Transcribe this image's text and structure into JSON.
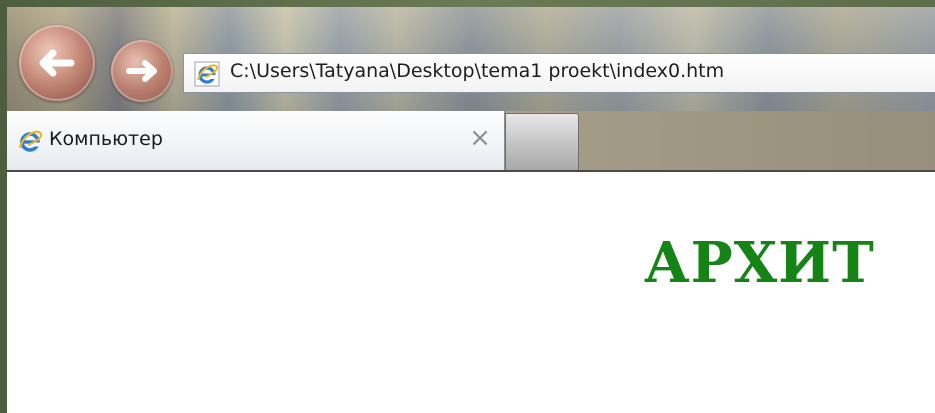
{
  "address_bar": {
    "url": "C:\\Users\\Tatyana\\Desktop\\tema1 proekt\\index0.htm"
  },
  "tab": {
    "title": "Компьютер",
    "close_glyph": "×"
  },
  "page": {
    "heading": "АРХИТ"
  },
  "icons": {
    "back": "back-arrow-icon",
    "forward": "forward-arrow-icon",
    "page": "ie-logo-icon"
  },
  "colors": {
    "heading": "#168317",
    "ie_blue": "#2a7fd4",
    "ie_orange": "#f0b428"
  }
}
